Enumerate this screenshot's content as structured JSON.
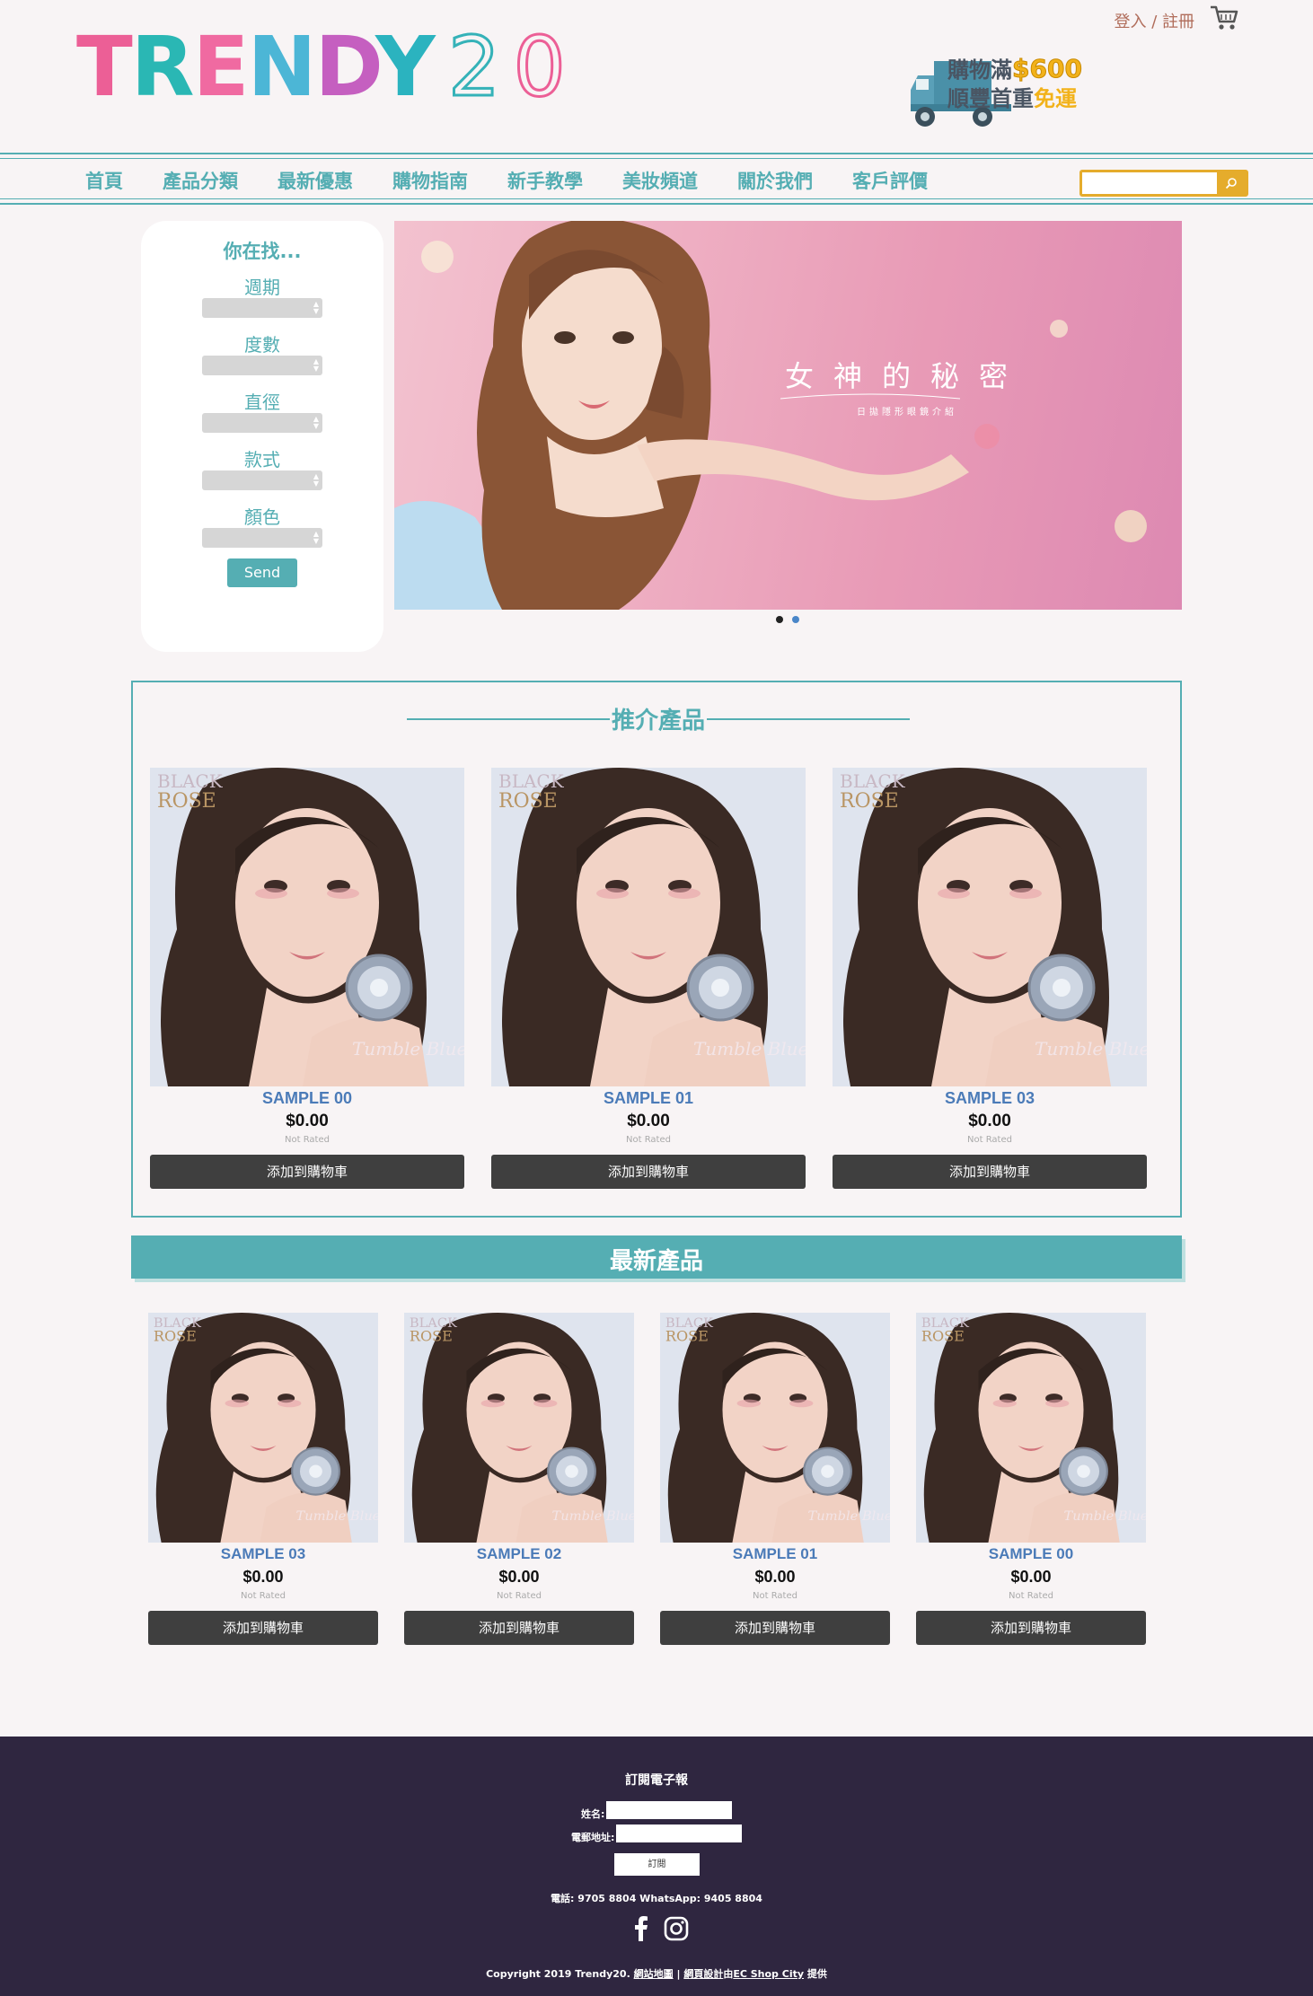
{
  "header": {
    "logo_text": "TRENDY 20",
    "login_label": "登入 / 註冊",
    "promo_line1": "購物滿",
    "promo_amount": "$600",
    "promo_line2a": "順豐首重",
    "promo_line2b": "免運"
  },
  "nav": {
    "items": [
      {
        "label": "首頁"
      },
      {
        "label": "產品分類"
      },
      {
        "label": "最新優惠"
      },
      {
        "label": "購物指南"
      },
      {
        "label": "新手教學"
      },
      {
        "label": "美妝頻道"
      },
      {
        "label": "關於我們"
      },
      {
        "label": "客戶評價"
      }
    ],
    "search_placeholder": ""
  },
  "filter": {
    "title": "你在找...",
    "fields": [
      {
        "label": "週期"
      },
      {
        "label": "度數"
      },
      {
        "label": "直徑"
      },
      {
        "label": "款式"
      },
      {
        "label": "顏色"
      }
    ],
    "send_label": "Send"
  },
  "banner": {
    "title": "女神的秘密",
    "subtitle": "日拋隱形眼鏡介紹"
  },
  "recommended": {
    "title": "推介產品",
    "products": [
      {
        "name": "SAMPLE 00",
        "price": "$0.00",
        "rating": "Not Rated",
        "button": "添加到購物車"
      },
      {
        "name": "SAMPLE 01",
        "price": "$0.00",
        "rating": "Not Rated",
        "button": "添加到購物車"
      },
      {
        "name": "SAMPLE 03",
        "price": "$0.00",
        "rating": "Not Rated",
        "button": "添加到購物車"
      }
    ]
  },
  "latest": {
    "title": "最新產品",
    "products": [
      {
        "name": "SAMPLE 03",
        "price": "$0.00",
        "rating": "Not Rated",
        "button": "添加到購物車"
      },
      {
        "name": "SAMPLE 02",
        "price": "$0.00",
        "rating": "Not Rated",
        "button": "添加到購物車"
      },
      {
        "name": "SAMPLE 01",
        "price": "$0.00",
        "rating": "Not Rated",
        "button": "添加到購物車"
      },
      {
        "name": "SAMPLE 00",
        "price": "$0.00",
        "rating": "Not Rated",
        "button": "添加到購物車"
      }
    ]
  },
  "product_image_text": {
    "brand": "BLACK ROSE",
    "color_name": "Tumble Blue"
  },
  "footer": {
    "title": "訂閱電子報",
    "name_label": "姓名:",
    "email_label": "電郵地址:",
    "subscribe_label": "訂閱",
    "phone_line": "電話: 9705 8804 WhatsApp: 9405 8804",
    "copy_prefix": "Copyright 2019 Trendy20.",
    "sitemap_link": "網站地圖",
    "separator": "|",
    "design_link": "網頁設計",
    "by_text": "由",
    "provider_link": "EC Shop City",
    "provided_text": "提供"
  },
  "colors": {
    "brand_teal": "#55aeb3",
    "accent_gold": "#e5ac2c",
    "product_name_blue": "#4b7bb8",
    "button_dark": "#3f3f3f",
    "footer_bg": "#2f2640"
  }
}
